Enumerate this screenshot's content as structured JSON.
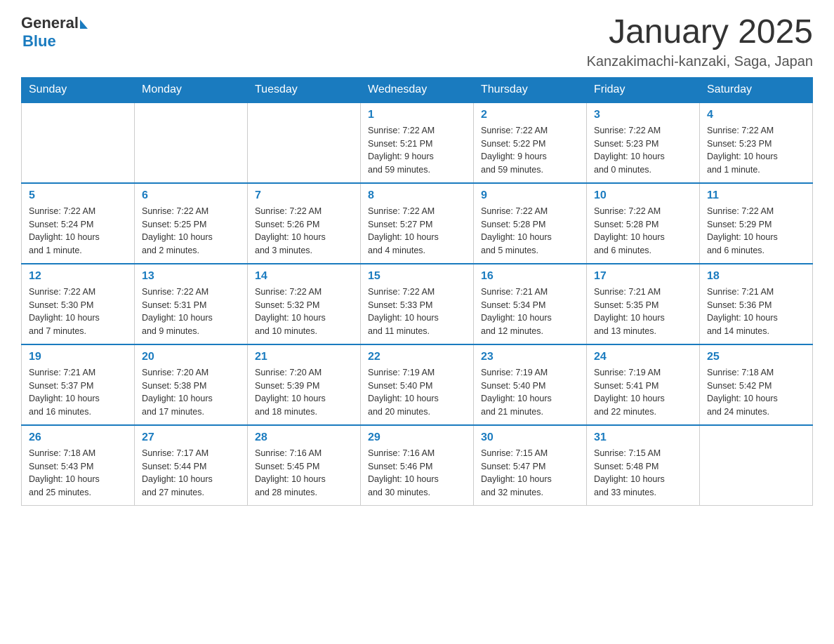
{
  "header": {
    "logo": {
      "text_general": "General",
      "text_blue": "Blue",
      "triangle": "▲"
    },
    "title": "January 2025",
    "subtitle": "Kanzakimachi-kanzaki, Saga, Japan"
  },
  "weekdays": [
    "Sunday",
    "Monday",
    "Tuesday",
    "Wednesday",
    "Thursday",
    "Friday",
    "Saturday"
  ],
  "weeks": [
    {
      "days": [
        {
          "number": "",
          "info": ""
        },
        {
          "number": "",
          "info": ""
        },
        {
          "number": "",
          "info": ""
        },
        {
          "number": "1",
          "info": "Sunrise: 7:22 AM\nSunset: 5:21 PM\nDaylight: 9 hours\nand 59 minutes."
        },
        {
          "number": "2",
          "info": "Sunrise: 7:22 AM\nSunset: 5:22 PM\nDaylight: 9 hours\nand 59 minutes."
        },
        {
          "number": "3",
          "info": "Sunrise: 7:22 AM\nSunset: 5:23 PM\nDaylight: 10 hours\nand 0 minutes."
        },
        {
          "number": "4",
          "info": "Sunrise: 7:22 AM\nSunset: 5:23 PM\nDaylight: 10 hours\nand 1 minute."
        }
      ]
    },
    {
      "days": [
        {
          "number": "5",
          "info": "Sunrise: 7:22 AM\nSunset: 5:24 PM\nDaylight: 10 hours\nand 1 minute."
        },
        {
          "number": "6",
          "info": "Sunrise: 7:22 AM\nSunset: 5:25 PM\nDaylight: 10 hours\nand 2 minutes."
        },
        {
          "number": "7",
          "info": "Sunrise: 7:22 AM\nSunset: 5:26 PM\nDaylight: 10 hours\nand 3 minutes."
        },
        {
          "number": "8",
          "info": "Sunrise: 7:22 AM\nSunset: 5:27 PM\nDaylight: 10 hours\nand 4 minutes."
        },
        {
          "number": "9",
          "info": "Sunrise: 7:22 AM\nSunset: 5:28 PM\nDaylight: 10 hours\nand 5 minutes."
        },
        {
          "number": "10",
          "info": "Sunrise: 7:22 AM\nSunset: 5:28 PM\nDaylight: 10 hours\nand 6 minutes."
        },
        {
          "number": "11",
          "info": "Sunrise: 7:22 AM\nSunset: 5:29 PM\nDaylight: 10 hours\nand 6 minutes."
        }
      ]
    },
    {
      "days": [
        {
          "number": "12",
          "info": "Sunrise: 7:22 AM\nSunset: 5:30 PM\nDaylight: 10 hours\nand 7 minutes."
        },
        {
          "number": "13",
          "info": "Sunrise: 7:22 AM\nSunset: 5:31 PM\nDaylight: 10 hours\nand 9 minutes."
        },
        {
          "number": "14",
          "info": "Sunrise: 7:22 AM\nSunset: 5:32 PM\nDaylight: 10 hours\nand 10 minutes."
        },
        {
          "number": "15",
          "info": "Sunrise: 7:22 AM\nSunset: 5:33 PM\nDaylight: 10 hours\nand 11 minutes."
        },
        {
          "number": "16",
          "info": "Sunrise: 7:21 AM\nSunset: 5:34 PM\nDaylight: 10 hours\nand 12 minutes."
        },
        {
          "number": "17",
          "info": "Sunrise: 7:21 AM\nSunset: 5:35 PM\nDaylight: 10 hours\nand 13 minutes."
        },
        {
          "number": "18",
          "info": "Sunrise: 7:21 AM\nSunset: 5:36 PM\nDaylight: 10 hours\nand 14 minutes."
        }
      ]
    },
    {
      "days": [
        {
          "number": "19",
          "info": "Sunrise: 7:21 AM\nSunset: 5:37 PM\nDaylight: 10 hours\nand 16 minutes."
        },
        {
          "number": "20",
          "info": "Sunrise: 7:20 AM\nSunset: 5:38 PM\nDaylight: 10 hours\nand 17 minutes."
        },
        {
          "number": "21",
          "info": "Sunrise: 7:20 AM\nSunset: 5:39 PM\nDaylight: 10 hours\nand 18 minutes."
        },
        {
          "number": "22",
          "info": "Sunrise: 7:19 AM\nSunset: 5:40 PM\nDaylight: 10 hours\nand 20 minutes."
        },
        {
          "number": "23",
          "info": "Sunrise: 7:19 AM\nSunset: 5:40 PM\nDaylight: 10 hours\nand 21 minutes."
        },
        {
          "number": "24",
          "info": "Sunrise: 7:19 AM\nSunset: 5:41 PM\nDaylight: 10 hours\nand 22 minutes."
        },
        {
          "number": "25",
          "info": "Sunrise: 7:18 AM\nSunset: 5:42 PM\nDaylight: 10 hours\nand 24 minutes."
        }
      ]
    },
    {
      "days": [
        {
          "number": "26",
          "info": "Sunrise: 7:18 AM\nSunset: 5:43 PM\nDaylight: 10 hours\nand 25 minutes."
        },
        {
          "number": "27",
          "info": "Sunrise: 7:17 AM\nSunset: 5:44 PM\nDaylight: 10 hours\nand 27 minutes."
        },
        {
          "number": "28",
          "info": "Sunrise: 7:16 AM\nSunset: 5:45 PM\nDaylight: 10 hours\nand 28 minutes."
        },
        {
          "number": "29",
          "info": "Sunrise: 7:16 AM\nSunset: 5:46 PM\nDaylight: 10 hours\nand 30 minutes."
        },
        {
          "number": "30",
          "info": "Sunrise: 7:15 AM\nSunset: 5:47 PM\nDaylight: 10 hours\nand 32 minutes."
        },
        {
          "number": "31",
          "info": "Sunrise: 7:15 AM\nSunset: 5:48 PM\nDaylight: 10 hours\nand 33 minutes."
        },
        {
          "number": "",
          "info": ""
        }
      ]
    }
  ]
}
